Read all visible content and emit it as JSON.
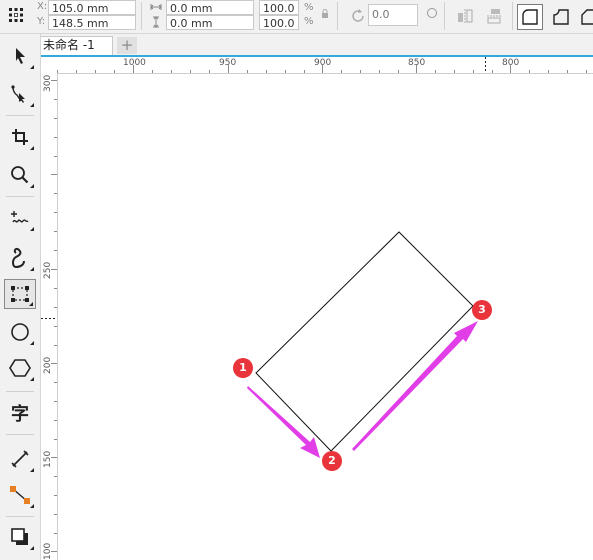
{
  "property_bar": {
    "x_label": "X:",
    "y_label": "Y:",
    "x_value": "105.0 mm",
    "y_value": "148.5 mm",
    "width_value": "0.0 mm",
    "height_value": "0.0 mm",
    "scale_x": "100.0",
    "scale_y": "100.0",
    "percent_sign": "%",
    "rotation": "0.0"
  },
  "document_tab": {
    "title": "未命名 -1",
    "add_label": "+"
  },
  "ruler": {
    "horizontal": [
      "1000",
      "950",
      "900",
      "850",
      "800"
    ],
    "vertical": [
      "300",
      "250",
      "200",
      "150",
      "100"
    ]
  },
  "annotations": {
    "markers": [
      "1",
      "2",
      "3"
    ],
    "marker_color": "#e8343a",
    "arrow_color": "#e23ee8"
  },
  "toolbox": {
    "glyph_text": "字"
  }
}
